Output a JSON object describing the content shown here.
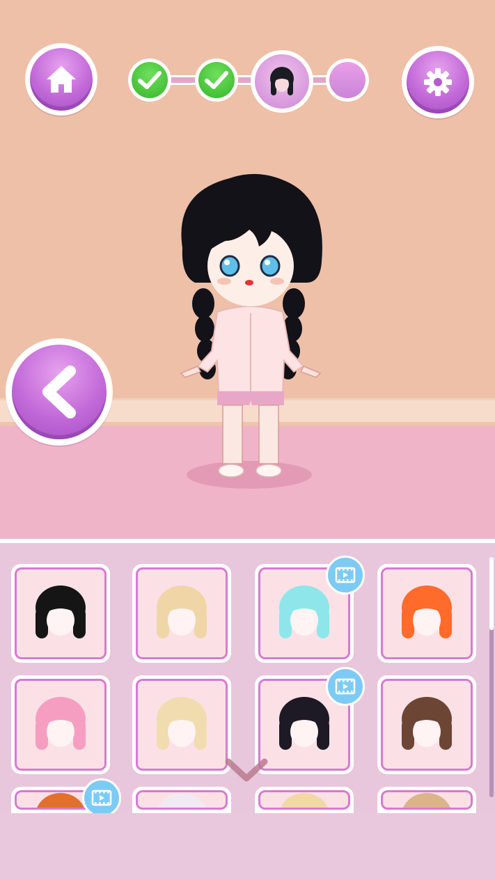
{
  "colors": {
    "wall": "#eec0a7",
    "floor": "#f0b4c8",
    "panel": "#e8c6dc",
    "accent_purple": "#c269d8",
    "done_green": "#36b52a",
    "video_blue": "#7dcbf4"
  },
  "header": {
    "home_icon": "home-icon",
    "settings_icon": "gear-icon",
    "progress": {
      "steps": [
        {
          "state": "done",
          "icon": "check-icon"
        },
        {
          "state": "done",
          "icon": "check-icon"
        },
        {
          "state": "current",
          "icon": "hair-icon"
        },
        {
          "state": "upcoming",
          "icon": ""
        }
      ]
    }
  },
  "stage": {
    "back_icon": "chevron-left-icon",
    "character": "doll-character"
  },
  "hair_grid": {
    "items": [
      {
        "style": "black bob",
        "color": "#151515",
        "video": false
      },
      {
        "style": "blonde wavy with clips",
        "color": "#f0d6a6",
        "video": false
      },
      {
        "style": "aqua curly",
        "color": "#8fe6ea",
        "video": true
      },
      {
        "style": "orange layered",
        "color": "#ff6b2a",
        "video": false
      },
      {
        "style": "pink straight",
        "color": "#f59ec2",
        "video": false
      },
      {
        "style": "cream bun",
        "color": "#f1dcb0",
        "video": false
      },
      {
        "style": "black long",
        "color": "#1d1a26",
        "video": true
      },
      {
        "style": "brown twintails",
        "color": "#6d4535",
        "video": false
      },
      {
        "style": "orange partial",
        "color": "#e1712a",
        "video": true
      },
      {
        "style": "white partial",
        "color": "#f2eaf2",
        "video": false
      },
      {
        "style": "blonde partial",
        "color": "#f0d9a6",
        "video": false
      },
      {
        "style": "tan partial",
        "color": "#dcb48a",
        "video": false
      }
    ],
    "video_icon": "video-ad-icon",
    "scroll_down_icon": "chevron-down-icon"
  }
}
